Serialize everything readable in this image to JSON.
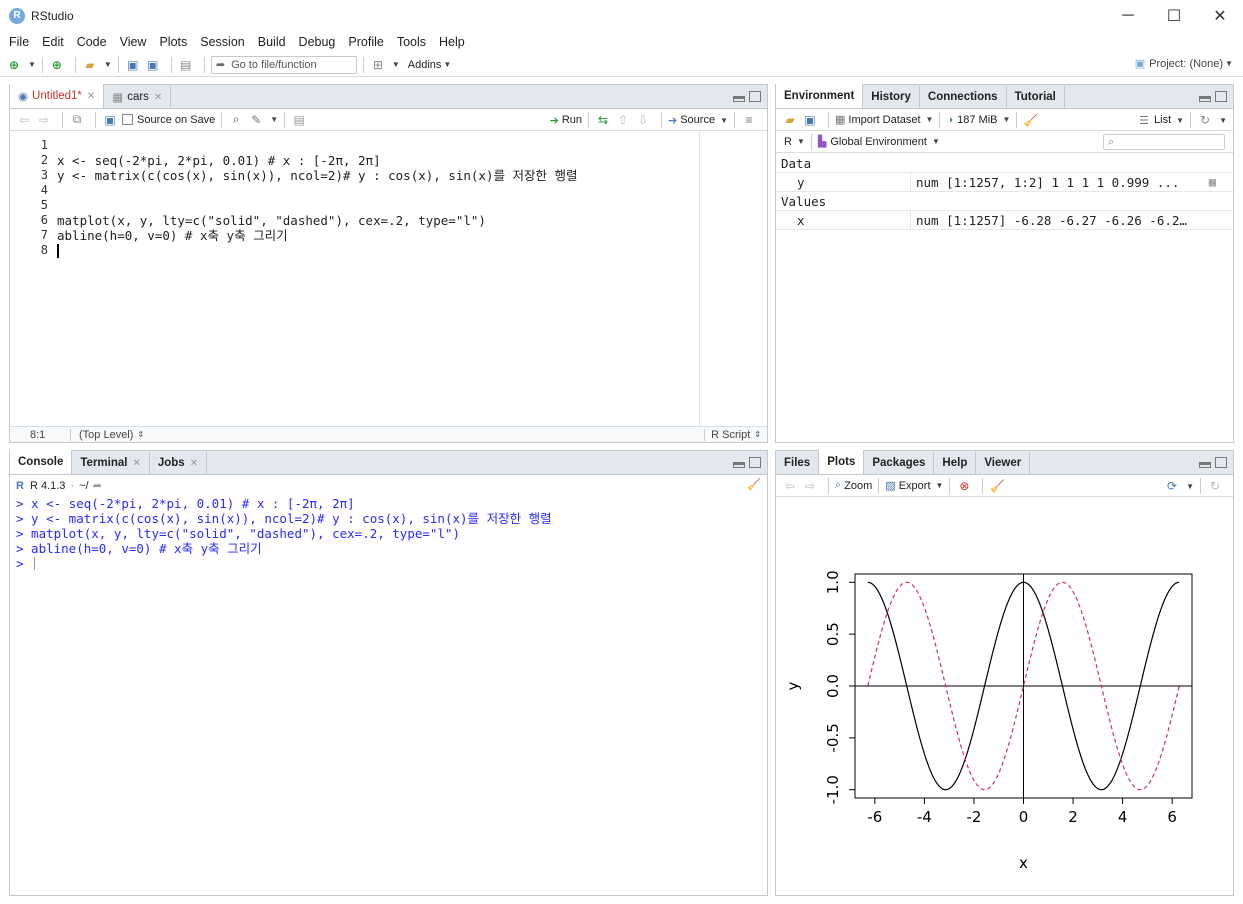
{
  "window": {
    "title": "RStudio",
    "app_icon": "R"
  },
  "menu": [
    "File",
    "Edit",
    "Code",
    "View",
    "Plots",
    "Session",
    "Build",
    "Debug",
    "Profile",
    "Tools",
    "Help"
  ],
  "toolbar": {
    "goto_placeholder": "Go to file/function",
    "addins": "Addins",
    "project": "Project: (None)"
  },
  "editor": {
    "tabs": [
      {
        "label": "Untitled1*",
        "active": true
      },
      {
        "label": "cars",
        "active": false
      }
    ],
    "source_on_save": "Source on Save",
    "run": "Run",
    "source": "Source",
    "lines": [
      {
        "n": "1",
        "code": ""
      },
      {
        "n": "2",
        "code": "x <- seq(-2*pi, 2*pi, 0.01) # x : [-2π, 2π]"
      },
      {
        "n": "3",
        "code": "y <- matrix(c(cos(x), sin(x)), ncol=2)# y : cos(x), sin(x)를 저장한 행렬"
      },
      {
        "n": "4",
        "code": ""
      },
      {
        "n": "5",
        "code": ""
      },
      {
        "n": "6",
        "code": "matplot(x, y, lty=c(\"solid\", \"dashed\"), cex=.2, type=\"l\")"
      },
      {
        "n": "7",
        "code": "abline(h=0, v=0) # x축 y축 그리기"
      },
      {
        "n": "8",
        "code": ""
      }
    ],
    "status": {
      "pos": "8:1",
      "scope": "(Top Level)",
      "lang": "R Script"
    }
  },
  "environment": {
    "tabs": [
      "Environment",
      "History",
      "Connections",
      "Tutorial"
    ],
    "import": "Import Dataset",
    "memory": "187 MiB",
    "list": "List",
    "lang": "R",
    "scope": "Global Environment",
    "data_header": "Data",
    "data_rows": [
      {
        "name": "y",
        "value": "num [1:1257, 1:2] 1 1 1 1 0.999 ..."
      }
    ],
    "values_header": "Values",
    "values_rows": [
      {
        "name": "x",
        "value": "num [1:1257] -6.28 -6.27 -6.26 -6.2…"
      }
    ]
  },
  "console": {
    "tabs": [
      "Console",
      "Terminal",
      "Jobs"
    ],
    "version": "R 4.1.3",
    "path": "~/",
    "lines": [
      "> x <- seq(-2*pi, 2*pi, 0.01) # x : [-2π, 2π]",
      "> y <- matrix(c(cos(x), sin(x)), ncol=2)# y : cos(x), sin(x)를 저장한 행렬",
      "> matplot(x, y, lty=c(\"solid\", \"dashed\"), cex=.2, type=\"l\")",
      "> abline(h=0, v=0) # x축 y축 그리기",
      "> "
    ]
  },
  "plots": {
    "tabs": [
      "Files",
      "Plots",
      "Packages",
      "Help",
      "Viewer"
    ],
    "zoom": "Zoom",
    "export": "Export"
  },
  "chart_data": {
    "type": "line",
    "xlabel": "x",
    "ylabel": "y",
    "xlim": [
      -6.28,
      6.28
    ],
    "ylim": [
      -1,
      1
    ],
    "xticks": [
      "-6",
      "-4",
      "-2",
      "0",
      "2",
      "4",
      "6"
    ],
    "yticks": [
      "-1.0",
      "-0.5",
      "0.0",
      "0.5",
      "1.0"
    ],
    "series": [
      {
        "function": "cos(x)",
        "style": "solid",
        "color": "#000000"
      },
      {
        "function": "sin(x)",
        "style": "dashed",
        "color": "#d62d5e"
      }
    ],
    "ablines": {
      "h": 0,
      "v": 0
    }
  }
}
